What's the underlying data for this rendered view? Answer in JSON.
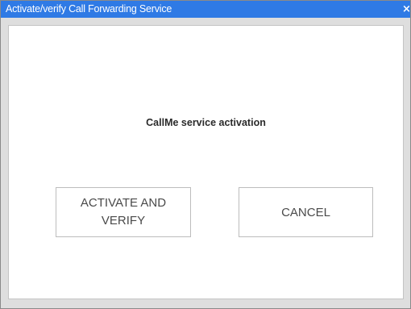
{
  "window": {
    "title": "Activate/verify Call Forwarding Service",
    "close_glyph": "×",
    "close_icon": "close-icon",
    "titlebar_color": "#2f7ae5"
  },
  "main": {
    "heading": "CallMe service activation",
    "buttons": {
      "activate_label": "ACTIVATE AND VERIFY",
      "cancel_label": "CANCEL"
    }
  }
}
